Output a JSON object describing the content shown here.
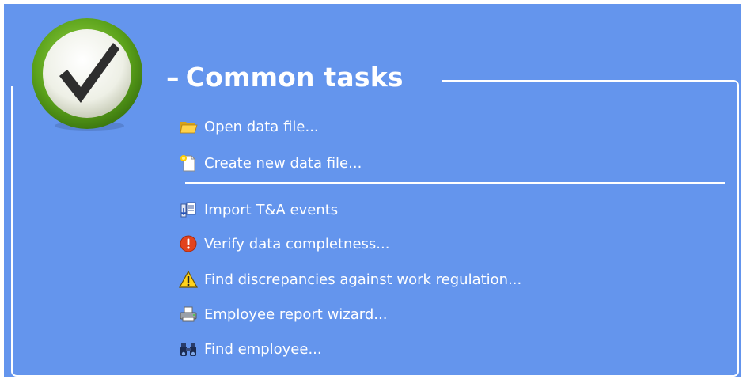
{
  "panel": {
    "title": "Common tasks",
    "title_prefix": "–",
    "accent": "#6495ed"
  },
  "logo": {
    "icon": "checkmark-icon"
  },
  "tasks_group_1": [
    {
      "label": "Open data file...",
      "icon": "open-folder-icon"
    },
    {
      "label": "Create new data file...",
      "icon": "new-file-icon"
    }
  ],
  "tasks_group_2": [
    {
      "label": "Import T&A events",
      "icon": "import-icon"
    },
    {
      "label": "Verify data completness...",
      "icon": "error-icon"
    },
    {
      "label": "Find discrepancies against work regulation...",
      "icon": "warning-icon"
    },
    {
      "label": "Employee report wizard...",
      "icon": "printer-icon"
    },
    {
      "label": "Find employee...",
      "icon": "binoculars-icon"
    }
  ]
}
